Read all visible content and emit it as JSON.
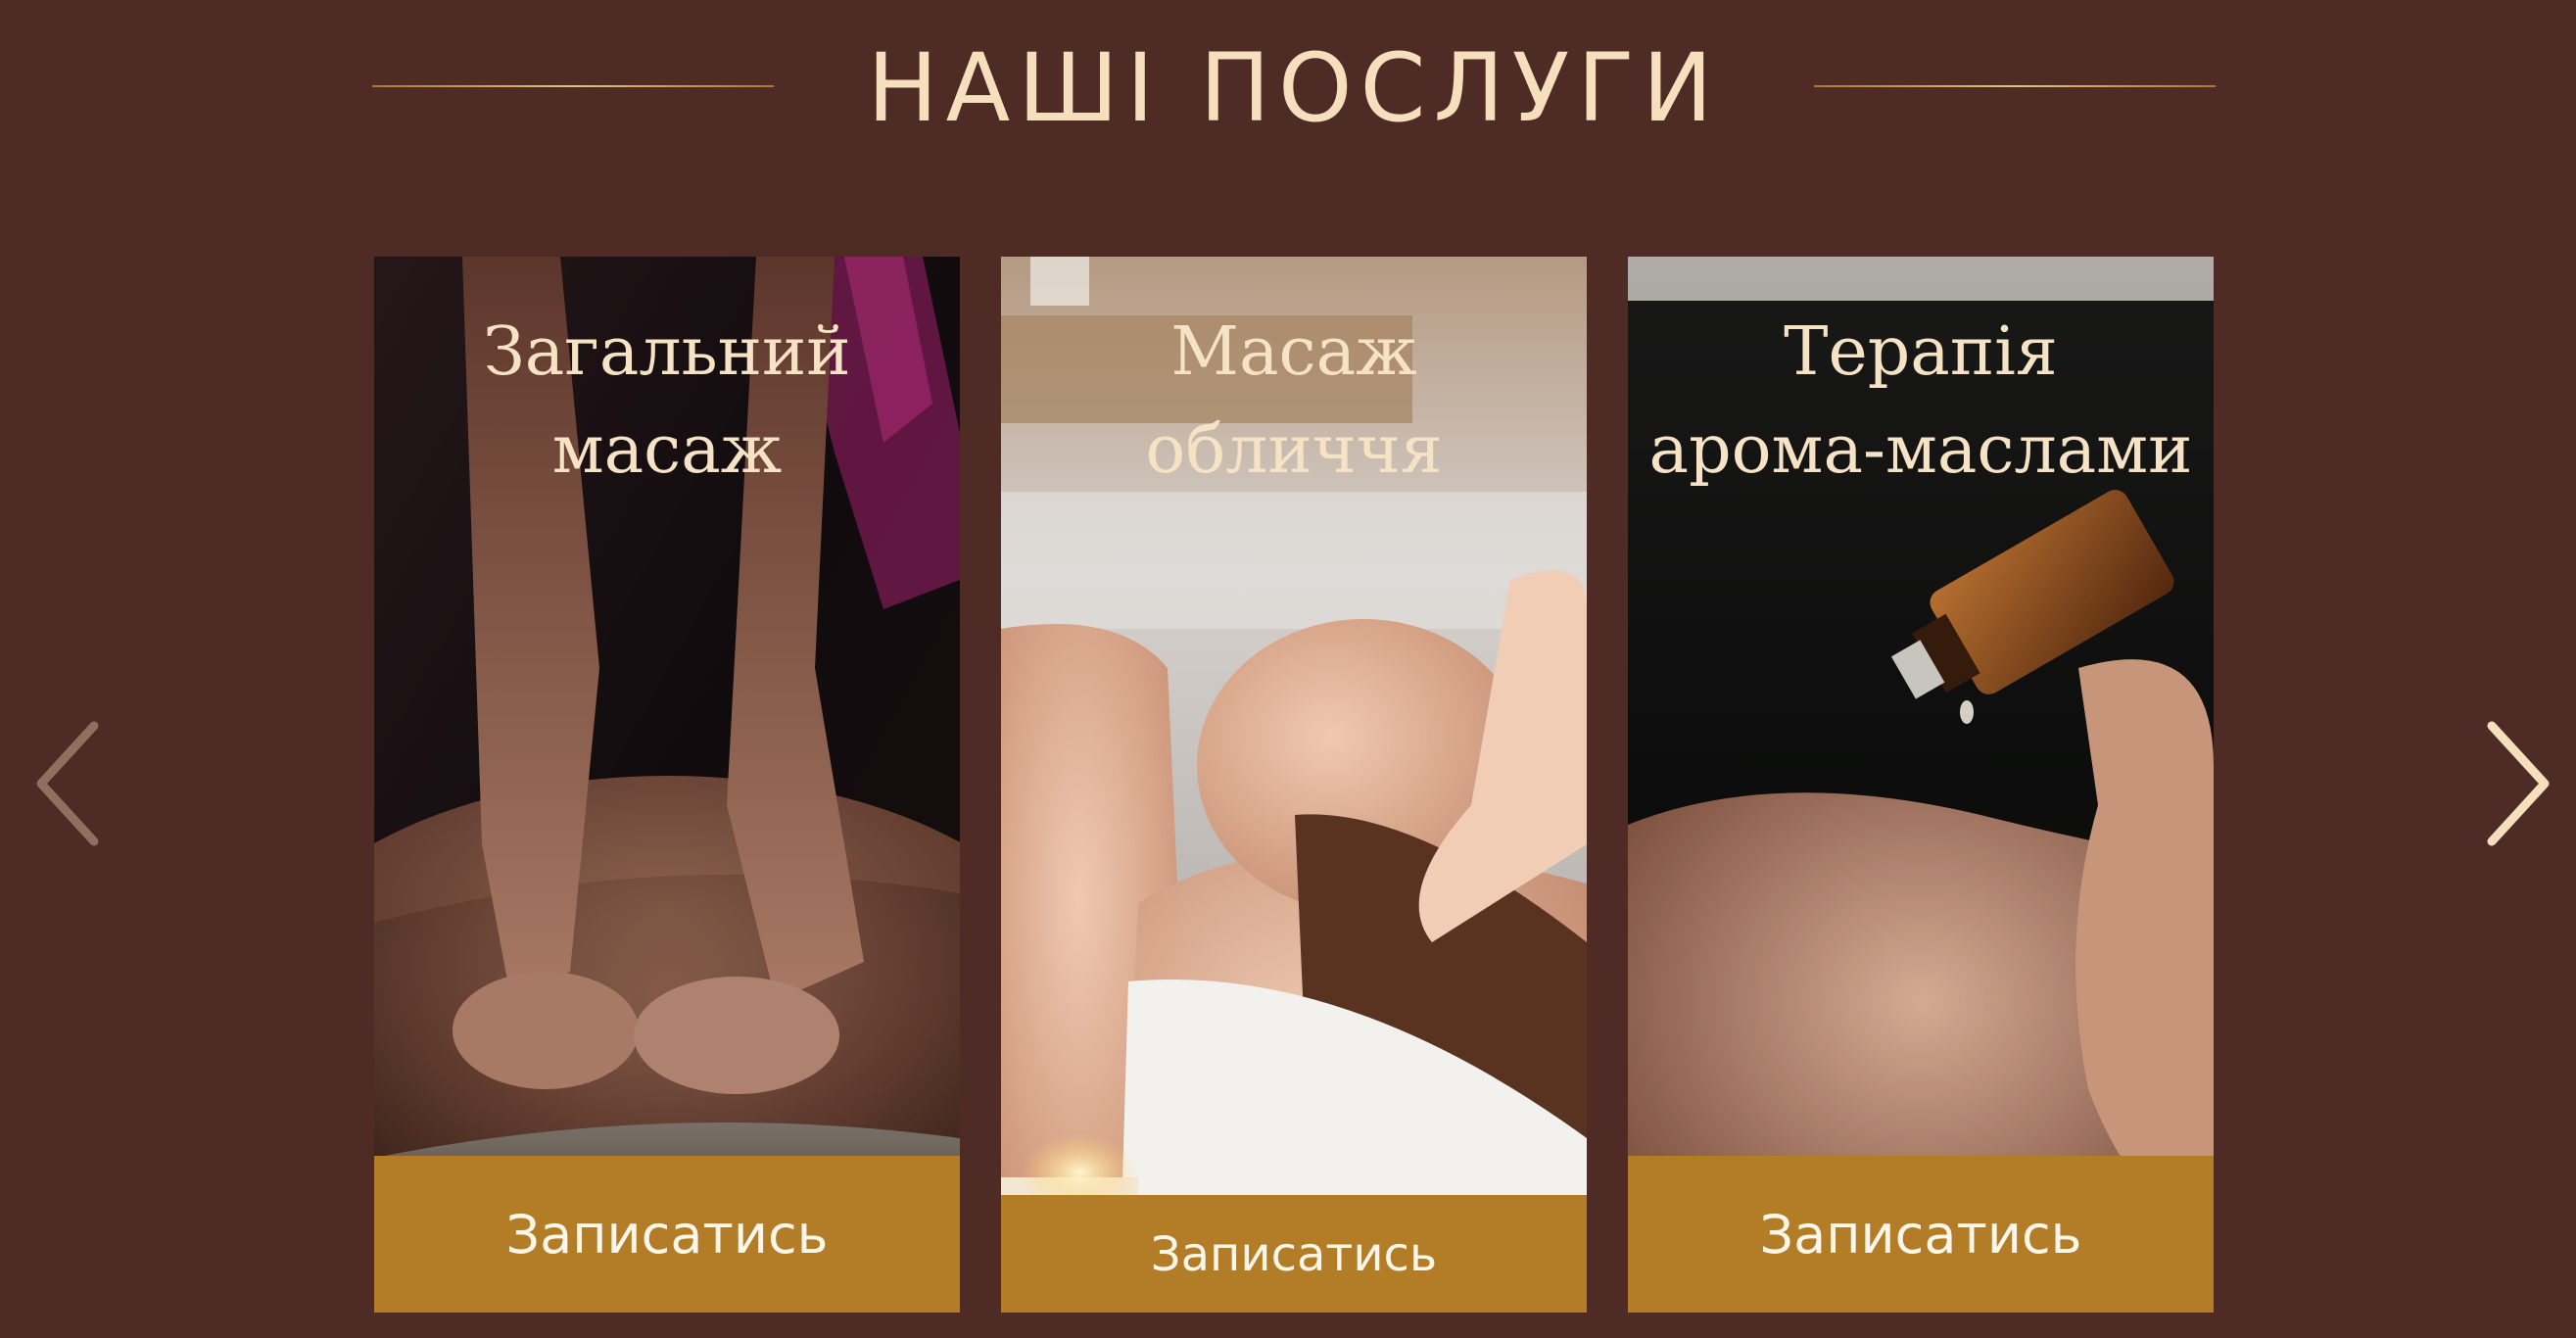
{
  "section": {
    "title": "НАШІ ПОСЛУГИ"
  },
  "colors": {
    "background": "#4e2b24",
    "accent_gold": "#b27d26",
    "title_text": "#f5dfbd",
    "arrow_prev": "#8f6f5d",
    "arrow_next": "#f5dfbd"
  },
  "cards": [
    {
      "title_lines": [
        "Загальний",
        "масаж"
      ],
      "button_label": "Записатись",
      "image": "back-massage-photo"
    },
    {
      "title_lines": [
        "Масаж",
        "обличчя"
      ],
      "button_label": "Записатись",
      "image": "face-massage-photo"
    },
    {
      "title_lines": [
        "Терапія",
        "арома-маслами"
      ],
      "button_label": "Записатись",
      "image": "aroma-oil-photo"
    }
  ],
  "navigation": {
    "prev_icon": "chevron-left-icon",
    "next_icon": "chevron-right-icon"
  }
}
